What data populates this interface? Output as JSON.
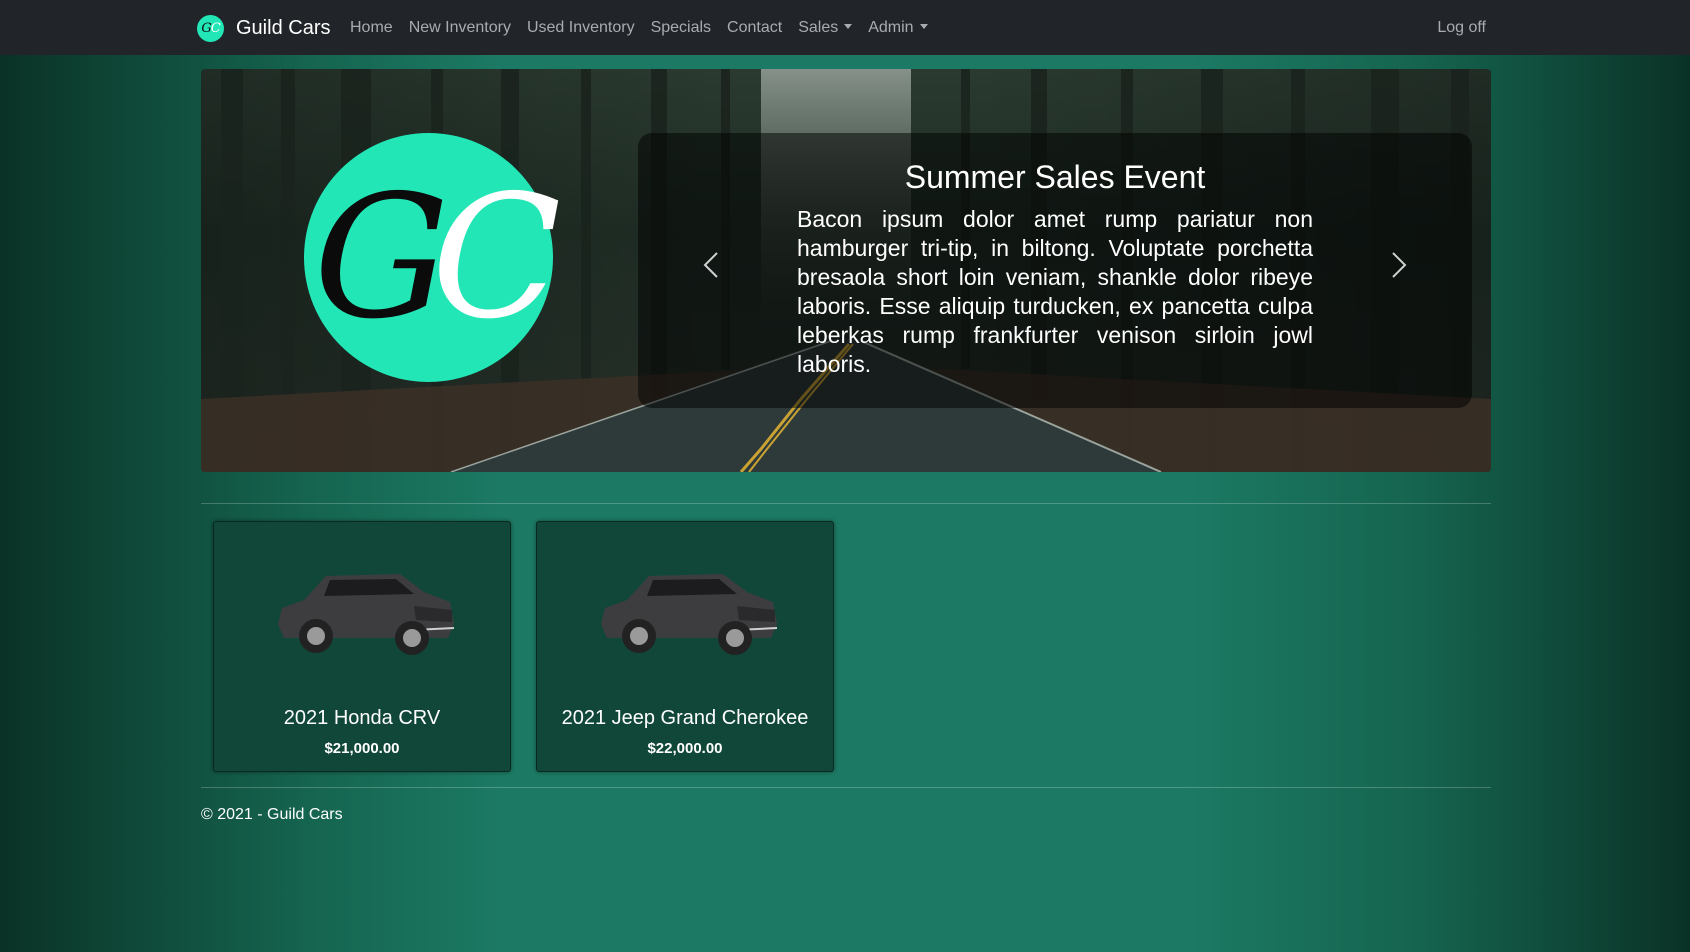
{
  "navbar": {
    "brand_logo_text": "GC",
    "brand_name": "Guild Cars",
    "links": [
      {
        "label": "Home"
      },
      {
        "label": "New Inventory"
      },
      {
        "label": "Used Inventory"
      },
      {
        "label": "Specials"
      },
      {
        "label": "Contact"
      },
      {
        "label": "Sales",
        "dropdown": true
      },
      {
        "label": "Admin",
        "dropdown": true
      }
    ],
    "logoff_label": "Log off"
  },
  "hero": {
    "logo_text": "GC",
    "caption_title": "Summer Sales Event",
    "caption_text": "Bacon ipsum dolor amet rump pariatur non hamburger tri-tip, in biltong. Voluptate porchetta bresaola short loin veniam, shankle dolor ribeye laboris. Esse aliquip turducken, ex pancetta culpa leberkas rump frankfurter venison sirloin jowl laboris.",
    "prev_icon": "chevron-left-icon",
    "next_icon": "chevron-right-icon"
  },
  "vehicles": [
    {
      "title": "2021 Honda CRV",
      "price": "$21,000.00",
      "image": "suv-image"
    },
    {
      "title": "2021 Jeep Grand Cherokee",
      "price": "$22,000.00",
      "image": "suv-image"
    }
  ],
  "footer": {
    "text": "© 2021 - Guild Cars"
  },
  "colors": {
    "navbar_bg": "#212529",
    "brand_accent": "#22e6b6",
    "page_bg": "#1c7a64",
    "card_bg": "#114739"
  }
}
